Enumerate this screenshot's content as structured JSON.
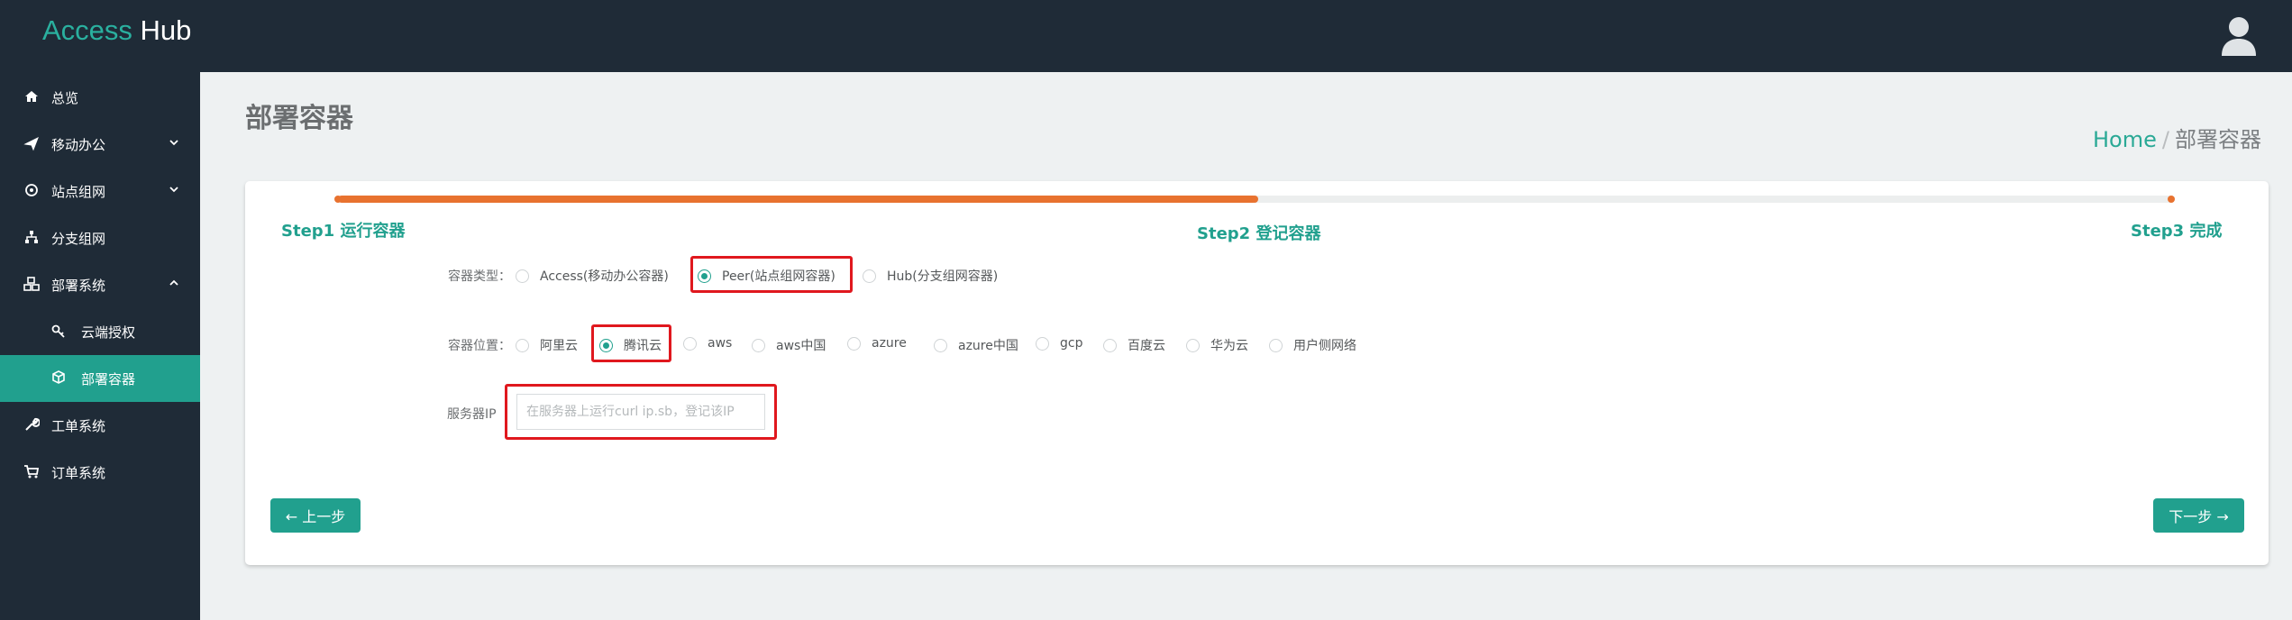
{
  "header": {
    "brand_accent": "Access",
    "brand_rest": "Hub"
  },
  "sidebar": {
    "items": [
      {
        "label": "总览",
        "icon": "home-icon"
      },
      {
        "label": "移动办公",
        "icon": "plane-icon"
      },
      {
        "label": "站点组网",
        "icon": "network-icon"
      },
      {
        "label": "分支组网",
        "icon": "sitemap-icon"
      },
      {
        "label": "部署系统",
        "icon": "cubes-icon"
      },
      {
        "label": "云端授权",
        "icon": "key-icon"
      },
      {
        "label": "部署容器",
        "icon": "cube-icon"
      },
      {
        "label": "工单系统",
        "icon": "wrench-icon"
      },
      {
        "label": "订单系统",
        "icon": "cart-icon"
      }
    ]
  },
  "page": {
    "title": "部署容器",
    "breadcrumb_home": "Home",
    "breadcrumb_sep": "/",
    "breadcrumb_current": "部署容器"
  },
  "wizard": {
    "progress_percent": 50,
    "steps": [
      "Step1 运行容器",
      "Step2 登记容器",
      "Step3 完成"
    ],
    "container_type": {
      "label": "容器类型：",
      "options": [
        "Access(移动办公容器)",
        "Peer(站点组网容器)",
        "Hub(分支组网容器)"
      ],
      "selected": "Peer(站点组网容器)"
    },
    "container_location": {
      "label": "容器位置：",
      "options": [
        "阿里云",
        "腾讯云",
        "aws",
        "aws中国",
        "azure",
        "azure中国",
        "gcp",
        "百度云",
        "华为云",
        "用户侧网络"
      ],
      "selected": "腾讯云"
    },
    "server_ip": {
      "label": "服务器IP",
      "value": "",
      "placeholder": "在服务器上运行curl ip.sb，登记该IP"
    },
    "prev_label": "← 上一步",
    "next_label": "下一步 →"
  },
  "colors": {
    "accent": "#21a08e",
    "progress": "#e8722f",
    "highlight": "#e0181e",
    "sidebar_bg": "#1f2b37"
  }
}
